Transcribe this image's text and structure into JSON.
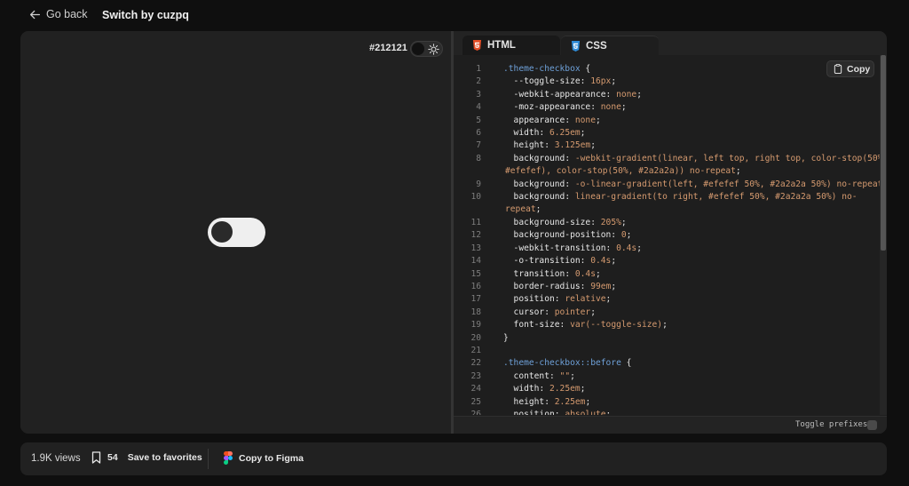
{
  "header": {
    "back_label": "Go back",
    "title": "Switch by cuzpq"
  },
  "preview": {
    "background_label": "#212121"
  },
  "editor": {
    "tabs": [
      {
        "label": "HTML",
        "active": false
      },
      {
        "label": "CSS",
        "active": true
      }
    ],
    "copy_label": "Copy",
    "toggle_prefixes_label": "Toggle prefixes",
    "lines": [
      {
        "n": "1",
        "parts": [
          {
            "t": ".theme-checkbox",
            "c": "sel"
          },
          {
            "t": " {",
            "c": "prop"
          }
        ]
      },
      {
        "n": "2",
        "parts": [
          {
            "t": "  --toggle-size",
            "c": "prop"
          },
          {
            "t": ": ",
            "c": "prop"
          },
          {
            "t": "16px",
            "c": "val"
          },
          {
            "t": ";",
            "c": "prop"
          }
        ]
      },
      {
        "n": "3",
        "parts": [
          {
            "t": "  -webkit-appearance",
            "c": "prop"
          },
          {
            "t": ": ",
            "c": "prop"
          },
          {
            "t": "none",
            "c": "val"
          },
          {
            "t": ";",
            "c": "prop"
          }
        ]
      },
      {
        "n": "4",
        "parts": [
          {
            "t": "  -moz-appearance",
            "c": "prop"
          },
          {
            "t": ": ",
            "c": "prop"
          },
          {
            "t": "none",
            "c": "val"
          },
          {
            "t": ";",
            "c": "prop"
          }
        ]
      },
      {
        "n": "5",
        "parts": [
          {
            "t": "  appearance",
            "c": "prop"
          },
          {
            "t": ": ",
            "c": "prop"
          },
          {
            "t": "none",
            "c": "val"
          },
          {
            "t": ";",
            "c": "prop"
          }
        ]
      },
      {
        "n": "6",
        "parts": [
          {
            "t": "  width",
            "c": "prop"
          },
          {
            "t": ": ",
            "c": "prop"
          },
          {
            "t": "6.25em",
            "c": "val"
          },
          {
            "t": ";",
            "c": "prop"
          }
        ]
      },
      {
        "n": "7",
        "parts": [
          {
            "t": "  height",
            "c": "prop"
          },
          {
            "t": ": ",
            "c": "prop"
          },
          {
            "t": "3.125em",
            "c": "val"
          },
          {
            "t": ";",
            "c": "prop"
          }
        ]
      },
      {
        "n": "8",
        "parts": [
          {
            "t": "  background",
            "c": "prop"
          },
          {
            "t": ": ",
            "c": "prop"
          },
          {
            "t": "-webkit-gradient(linear, left top, right top, color-stop(50%,",
            "c": "val"
          }
        ]
      },
      {
        "n": "",
        "parts": [
          {
            "t": "#efefef), color-stop(50%, #2a2a2a)) no-repeat",
            "c": "val"
          },
          {
            "t": ";",
            "c": "prop"
          }
        ]
      },
      {
        "n": "9",
        "parts": [
          {
            "t": "  background",
            "c": "prop"
          },
          {
            "t": ": ",
            "c": "prop"
          },
          {
            "t": "-o-linear-gradient(left, #efefef 50%, #2a2a2a 50%) no-repeat",
            "c": "val"
          },
          {
            "t": ";",
            "c": "prop"
          }
        ]
      },
      {
        "n": "10",
        "parts": [
          {
            "t": "  background",
            "c": "prop"
          },
          {
            "t": ": ",
            "c": "prop"
          },
          {
            "t": "linear-gradient(to right, #efefef 50%, #2a2a2a 50%) no-",
            "c": "val"
          }
        ]
      },
      {
        "n": "",
        "parts": [
          {
            "t": "repeat",
            "c": "val"
          },
          {
            "t": ";",
            "c": "prop"
          }
        ]
      },
      {
        "n": "11",
        "parts": [
          {
            "t": "  background-size",
            "c": "prop"
          },
          {
            "t": ": ",
            "c": "prop"
          },
          {
            "t": "205%",
            "c": "val"
          },
          {
            "t": ";",
            "c": "prop"
          }
        ]
      },
      {
        "n": "12",
        "parts": [
          {
            "t": "  background-position",
            "c": "prop"
          },
          {
            "t": ": ",
            "c": "prop"
          },
          {
            "t": "0",
            "c": "val"
          },
          {
            "t": ";",
            "c": "prop"
          }
        ]
      },
      {
        "n": "13",
        "parts": [
          {
            "t": "  -webkit-transition",
            "c": "prop"
          },
          {
            "t": ": ",
            "c": "prop"
          },
          {
            "t": "0.4s",
            "c": "val"
          },
          {
            "t": ";",
            "c": "prop"
          }
        ]
      },
      {
        "n": "14",
        "parts": [
          {
            "t": "  -o-transition",
            "c": "prop"
          },
          {
            "t": ": ",
            "c": "prop"
          },
          {
            "t": "0.4s",
            "c": "val"
          },
          {
            "t": ";",
            "c": "prop"
          }
        ]
      },
      {
        "n": "15",
        "parts": [
          {
            "t": "  transition",
            "c": "prop"
          },
          {
            "t": ": ",
            "c": "prop"
          },
          {
            "t": "0.4s",
            "c": "val"
          },
          {
            "t": ";",
            "c": "prop"
          }
        ]
      },
      {
        "n": "16",
        "parts": [
          {
            "t": "  border-radius",
            "c": "prop"
          },
          {
            "t": ": ",
            "c": "prop"
          },
          {
            "t": "99em",
            "c": "val"
          },
          {
            "t": ";",
            "c": "prop"
          }
        ]
      },
      {
        "n": "17",
        "parts": [
          {
            "t": "  position",
            "c": "prop"
          },
          {
            "t": ": ",
            "c": "prop"
          },
          {
            "t": "relative",
            "c": "val"
          },
          {
            "t": ";",
            "c": "prop"
          }
        ]
      },
      {
        "n": "18",
        "parts": [
          {
            "t": "  cursor",
            "c": "prop"
          },
          {
            "t": ": ",
            "c": "prop"
          },
          {
            "t": "pointer",
            "c": "val"
          },
          {
            "t": ";",
            "c": "prop"
          }
        ]
      },
      {
        "n": "19",
        "parts": [
          {
            "t": "  font-size",
            "c": "prop"
          },
          {
            "t": ": ",
            "c": "prop"
          },
          {
            "t": "var(--toggle-size)",
            "c": "val"
          },
          {
            "t": ";",
            "c": "prop"
          }
        ]
      },
      {
        "n": "20",
        "parts": [
          {
            "t": "}",
            "c": "prop"
          }
        ]
      },
      {
        "n": "21",
        "parts": []
      },
      {
        "n": "22",
        "parts": [
          {
            "t": ".theme-checkbox::before",
            "c": "sel"
          },
          {
            "t": " {",
            "c": "prop"
          }
        ]
      },
      {
        "n": "23",
        "parts": [
          {
            "t": "  content",
            "c": "prop"
          },
          {
            "t": ": ",
            "c": "prop"
          },
          {
            "t": "\"\"",
            "c": "val"
          },
          {
            "t": ";",
            "c": "prop"
          }
        ]
      },
      {
        "n": "24",
        "parts": [
          {
            "t": "  width",
            "c": "prop"
          },
          {
            "t": ": ",
            "c": "prop"
          },
          {
            "t": "2.25em",
            "c": "val"
          },
          {
            "t": ";",
            "c": "prop"
          }
        ]
      },
      {
        "n": "25",
        "parts": [
          {
            "t": "  height",
            "c": "prop"
          },
          {
            "t": ": ",
            "c": "prop"
          },
          {
            "t": "2.25em",
            "c": "val"
          },
          {
            "t": ";",
            "c": "prop"
          }
        ]
      },
      {
        "n": "26",
        "parts": [
          {
            "t": "  position",
            "c": "prop"
          },
          {
            "t": ": ",
            "c": "prop"
          },
          {
            "t": "absolute",
            "c": "val"
          },
          {
            "t": ";",
            "c": "prop"
          }
        ]
      }
    ]
  },
  "footer": {
    "views": "1.9K views",
    "favorites_count": "54",
    "favorites_label": "Save to favorites",
    "figma_label": "Copy to Figma"
  },
  "colors": {
    "background": "#0f0f0f",
    "panel": "#212121",
    "selector": "#6ea0d8",
    "value": "#d59a6f",
    "html_icon": "#e44d26",
    "css_icon": "#2f8bd6"
  }
}
